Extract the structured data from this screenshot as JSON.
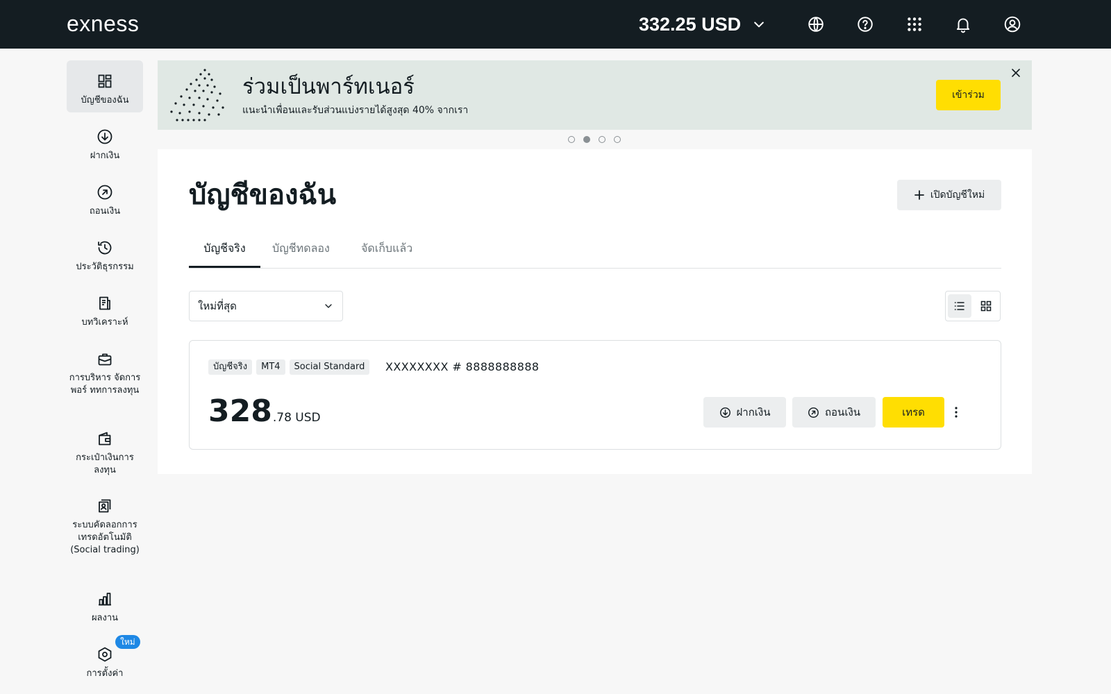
{
  "header": {
    "logo": "exness",
    "balance": "332.25 USD",
    "icons": [
      "globe-icon",
      "help-icon",
      "apps-grid-icon",
      "bell-icon",
      "user-icon"
    ]
  },
  "sidebar": {
    "items": [
      {
        "label": "บัญชีของฉัน",
        "icon": "dashboard-icon",
        "active": true
      },
      {
        "label": "ฝากเงิน",
        "icon": "deposit-icon"
      },
      {
        "label": "ถอนเงิน",
        "icon": "withdraw-icon"
      },
      {
        "label": "ประวัติธุรกรรม",
        "icon": "history-icon"
      },
      {
        "label": "บทวิเคราะห์",
        "icon": "analytics-icon"
      },
      {
        "label": "การบริหาร จัดการ พอร์ ททการลงทุน",
        "icon": "portfolio-icon"
      },
      {
        "label": "กระเป๋าเงินการ ลงทุน",
        "icon": "wallet-icon"
      },
      {
        "label": "ระบบคัดลอกการ เทรดอัตโนมัติ (Social trading)",
        "icon": "social-trading-icon"
      },
      {
        "label": "ผลงาน",
        "icon": "performance-icon"
      },
      {
        "label": "การตั้งค่า",
        "icon": "settings-icon",
        "badge": "ใหม่"
      }
    ]
  },
  "banner": {
    "title": "ร่วมเป็นพาร์ทเนอร์",
    "subtitle": "แนะนำเพื่อนและรับส่วนแบ่งรายได้สูงสุด 40% จากเรา",
    "cta": "เข้าร่วม",
    "slides": 4,
    "active_slide": 2
  },
  "main": {
    "title": "บัญชีของฉัน",
    "open_account": "เปิดบัญชีใหม่",
    "tabs": [
      {
        "label": "บัญชีจริง",
        "active": true
      },
      {
        "label": "บัญชีทดลอง"
      },
      {
        "label": "จัดเก็บแล้ว"
      }
    ],
    "sort": {
      "selected": "ใหม่ที่สุด"
    },
    "view_mode": "list"
  },
  "account": {
    "tags": [
      "บัญชีจริง",
      "MT4",
      "Social Standard"
    ],
    "name": "XXXXXXXX",
    "number": "# 8888888888",
    "balance_int": "328",
    "balance_dec": ".78 USD",
    "deposit": "ฝากเงิน",
    "withdraw": "ถอนเงิน",
    "trade": "เทรด"
  },
  "colors": {
    "topbar": "#141d22",
    "accent_yellow": "#ffde02",
    "banner_bg": "#e0e8e4",
    "badge_blue": "#1e88e5"
  }
}
